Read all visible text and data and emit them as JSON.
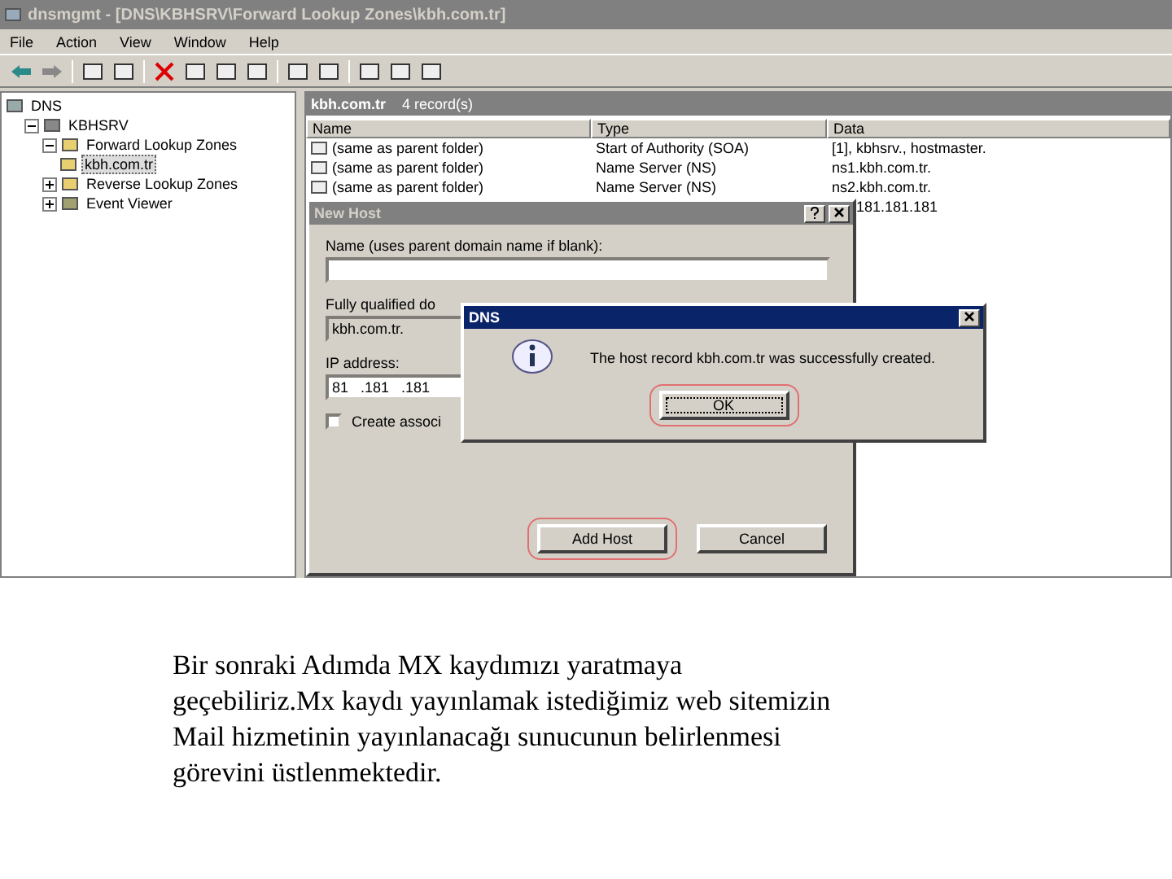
{
  "window": {
    "title": "dnsmgmt - [DNS\\KBHSRV\\Forward Lookup Zones\\kbh.com.tr]"
  },
  "menu": [
    "File",
    "Action",
    "View",
    "Window",
    "Help"
  ],
  "tree": [
    {
      "label": "DNS",
      "kind": "root",
      "selected": false,
      "children": [
        {
          "label": "KBHSRV",
          "kind": "server",
          "selected": false,
          "expanded": true,
          "children": [
            {
              "label": "Forward Lookup Zones",
              "kind": "folder",
              "selected": false,
              "expanded": true,
              "children": [
                {
                  "label": "kbh.com.tr",
                  "kind": "zone",
                  "selected": true
                }
              ]
            },
            {
              "label": "Reverse Lookup Zones",
              "kind": "folder",
              "selected": false,
              "expanded": false
            },
            {
              "label": "Event Viewer",
              "kind": "log",
              "selected": false,
              "expanded": false
            }
          ]
        }
      ]
    }
  ],
  "list": {
    "title": "kbh.com.tr",
    "count": "4 record(s)",
    "columns": [
      "Name",
      "Type",
      "Data"
    ],
    "rows": [
      [
        "(same as parent folder)",
        "Start of Authority (SOA)",
        "[1], kbhsrv., hostmaster."
      ],
      [
        "(same as parent folder)",
        "Name Server (NS)",
        "ns1.kbh.com.tr."
      ],
      [
        "(same as parent folder)",
        "Name Server (NS)",
        "ns2.kbh.com.tr."
      ],
      [
        "",
        "",
        "181.181.181"
      ]
    ]
  },
  "new_host_dialog": {
    "title": "New Host",
    "name_label": "Name (uses parent domain name if blank):",
    "fqdn_label": "Fully qualified do",
    "fqdn_value": "kbh.com.tr.",
    "ip_label": "IP address:",
    "ip_value": "81   .181   .181",
    "checkbox": {
      "label": "Create associ",
      "checked": false
    },
    "buttons": [
      {
        "label": "Add Host",
        "highlighted": true
      },
      {
        "label": "Cancel",
        "highlighted": false
      }
    ]
  },
  "message_box": {
    "title": "DNS",
    "message": "The host record kbh.com.tr was successfully created.",
    "button": {
      "label": "OK",
      "highlighted": true
    }
  },
  "caption": " Bir sonraki Adımda MX kaydımızı yaratmaya\ngeçebiliriz.Mx kaydı yayınlamak istediğimiz web sitemizin\nMail hizmetinin yayınlanacağı sunucunun belirlenmesi\ngörevini üstlenmektedir."
}
